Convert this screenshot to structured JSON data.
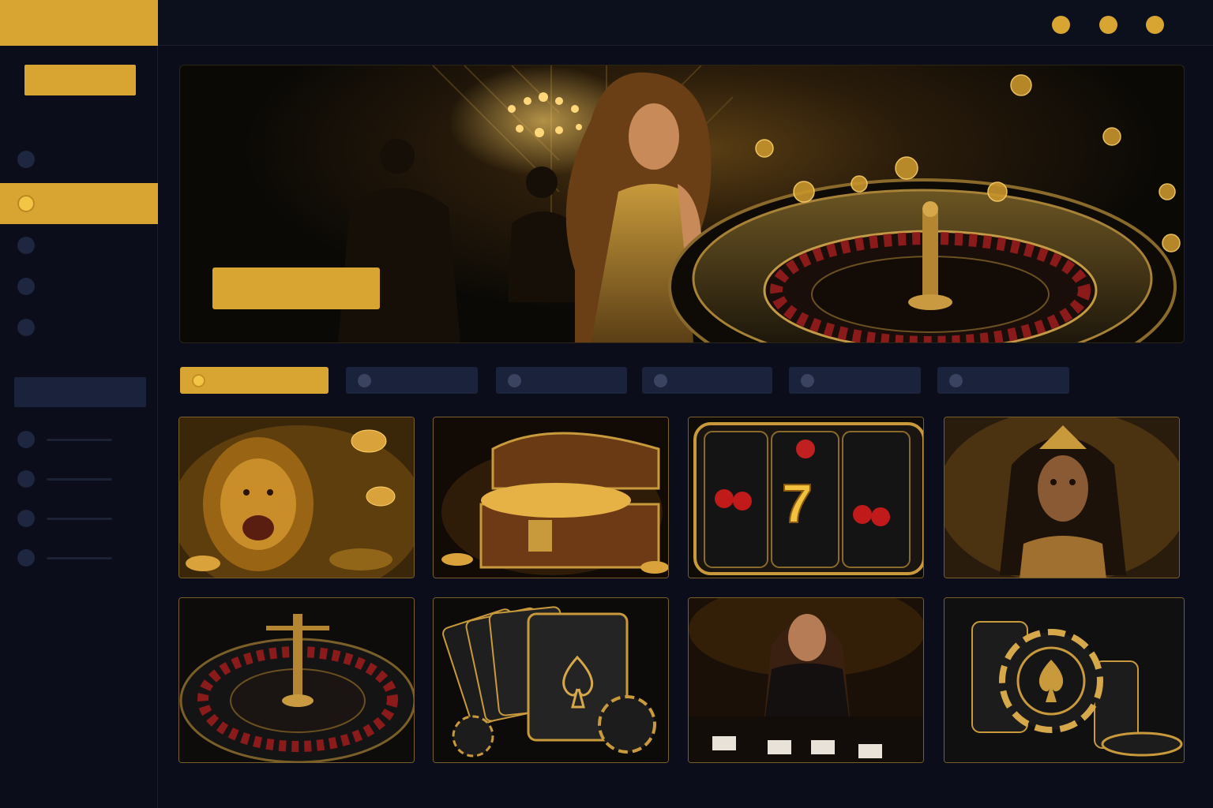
{
  "window": {
    "controls": [
      {
        "name": "window-control-1"
      },
      {
        "name": "window-control-2"
      },
      {
        "name": "window-control-3"
      }
    ]
  },
  "theme": {
    "accent": "#d8a532",
    "background": "#0b0e1a",
    "panel": "#1b233c",
    "dot_inactive": "#1e2640"
  },
  "sidebar": {
    "primary_button": "",
    "nav_items": [
      {
        "id": "nav-1",
        "active": false
      },
      {
        "id": "nav-2",
        "active": true
      },
      {
        "id": "nav-3",
        "active": false
      },
      {
        "id": "nav-4",
        "active": false
      },
      {
        "id": "nav-5",
        "active": false
      }
    ],
    "section_header": "",
    "sub_items": [
      {
        "id": "sub-1"
      },
      {
        "id": "sub-2"
      },
      {
        "id": "sub-3"
      },
      {
        "id": "sub-4"
      }
    ]
  },
  "hero": {
    "cta_label": "",
    "image": "casino-hero-roulette-woman"
  },
  "filters": [
    {
      "id": "filter-1",
      "active": true
    },
    {
      "id": "filter-2",
      "active": false
    },
    {
      "id": "filter-3",
      "active": false
    },
    {
      "id": "filter-4",
      "active": false
    },
    {
      "id": "filter-5",
      "active": false
    },
    {
      "id": "filter-6",
      "active": false
    }
  ],
  "games": [
    {
      "image": "lion-slot-icon"
    },
    {
      "image": "treasure-chest-icon"
    },
    {
      "image": "slot-reels-seven-icon"
    },
    {
      "image": "goddess-slot-icon"
    },
    {
      "image": "roulette-wheel-icon"
    },
    {
      "image": "playing-cards-aces-icon"
    },
    {
      "image": "live-dealer-icon"
    },
    {
      "image": "poker-chips-icon"
    }
  ]
}
